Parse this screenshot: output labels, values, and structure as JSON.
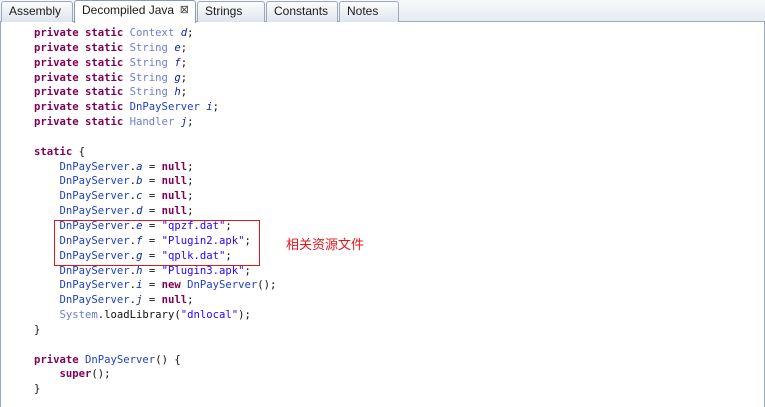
{
  "tabs": [
    {
      "label": "Assembly",
      "active": false
    },
    {
      "label": "Decompiled Java",
      "active": true,
      "close_glyph": "⊠"
    },
    {
      "label": "Strings",
      "active": false
    },
    {
      "label": "Constants",
      "active": false
    },
    {
      "label": "Notes",
      "active": false
    }
  ],
  "code_lines": [
    [
      {
        "t": "private static ",
        "c": "kw"
      },
      {
        "t": "Context",
        "c": "typ"
      },
      {
        "t": " d",
        "c": "fld"
      },
      {
        "t": ";",
        "c": "plain"
      }
    ],
    [
      {
        "t": "private static ",
        "c": "kw"
      },
      {
        "t": "String",
        "c": "typ"
      },
      {
        "t": " e",
        "c": "fld"
      },
      {
        "t": ";",
        "c": "plain"
      }
    ],
    [
      {
        "t": "private static ",
        "c": "kw"
      },
      {
        "t": "String",
        "c": "typ"
      },
      {
        "t": " f",
        "c": "fld"
      },
      {
        "t": ";",
        "c": "plain"
      }
    ],
    [
      {
        "t": "private static ",
        "c": "kw"
      },
      {
        "t": "String",
        "c": "typ"
      },
      {
        "t": " g",
        "c": "fld"
      },
      {
        "t": ";",
        "c": "plain"
      }
    ],
    [
      {
        "t": "private static ",
        "c": "kw"
      },
      {
        "t": "String",
        "c": "typ"
      },
      {
        "t": " h",
        "c": "fld"
      },
      {
        "t": ";",
        "c": "plain"
      }
    ],
    [
      {
        "t": "private static ",
        "c": "kw"
      },
      {
        "t": "DnPayServer",
        "c": "cls"
      },
      {
        "t": " i",
        "c": "fld"
      },
      {
        "t": ";",
        "c": "plain"
      }
    ],
    [
      {
        "t": "private static ",
        "c": "kw"
      },
      {
        "t": "Handler",
        "c": "typ"
      },
      {
        "t": " j",
        "c": "fld"
      },
      {
        "t": ";",
        "c": "plain"
      }
    ],
    [],
    [
      {
        "t": "static",
        "c": "kw"
      },
      {
        "t": " {",
        "c": "plain"
      }
    ],
    [
      {
        "t": "    DnPayServer",
        "c": "cls"
      },
      {
        "t": ".",
        "c": "plain"
      },
      {
        "t": "a",
        "c": "fld"
      },
      {
        "t": " = ",
        "c": "plain"
      },
      {
        "t": "null",
        "c": "kw"
      },
      {
        "t": ";",
        "c": "plain"
      }
    ],
    [
      {
        "t": "    DnPayServer",
        "c": "cls"
      },
      {
        "t": ".",
        "c": "plain"
      },
      {
        "t": "b",
        "c": "fld"
      },
      {
        "t": " = ",
        "c": "plain"
      },
      {
        "t": "null",
        "c": "kw"
      },
      {
        "t": ";",
        "c": "plain"
      }
    ],
    [
      {
        "t": "    DnPayServer",
        "c": "cls"
      },
      {
        "t": ".",
        "c": "plain"
      },
      {
        "t": "c",
        "c": "fld"
      },
      {
        "t": " = ",
        "c": "plain"
      },
      {
        "t": "null",
        "c": "kw"
      },
      {
        "t": ";",
        "c": "plain"
      }
    ],
    [
      {
        "t": "    DnPayServer",
        "c": "cls"
      },
      {
        "t": ".",
        "c": "plain"
      },
      {
        "t": "d",
        "c": "fld"
      },
      {
        "t": " = ",
        "c": "plain"
      },
      {
        "t": "null",
        "c": "kw"
      },
      {
        "t": ";",
        "c": "plain"
      }
    ],
    [
      {
        "t": "    DnPayServer",
        "c": "cls"
      },
      {
        "t": ".",
        "c": "plain"
      },
      {
        "t": "e",
        "c": "fld"
      },
      {
        "t": " = ",
        "c": "plain"
      },
      {
        "t": "\"qpzf.dat\"",
        "c": "str"
      },
      {
        "t": ";",
        "c": "plain"
      }
    ],
    [
      {
        "t": "    DnPayServer",
        "c": "cls"
      },
      {
        "t": ".",
        "c": "plain"
      },
      {
        "t": "f",
        "c": "fld"
      },
      {
        "t": " = ",
        "c": "plain"
      },
      {
        "t": "\"Plugin2.apk\"",
        "c": "str"
      },
      {
        "t": ";",
        "c": "plain"
      }
    ],
    [
      {
        "t": "    DnPayServer",
        "c": "cls"
      },
      {
        "t": ".",
        "c": "plain"
      },
      {
        "t": "g",
        "c": "fld"
      },
      {
        "t": " = ",
        "c": "plain"
      },
      {
        "t": "\"qplk.dat\"",
        "c": "str"
      },
      {
        "t": ";",
        "c": "plain"
      }
    ],
    [
      {
        "t": "    DnPayServer",
        "c": "cls"
      },
      {
        "t": ".",
        "c": "plain"
      },
      {
        "t": "h",
        "c": "fld"
      },
      {
        "t": " = ",
        "c": "plain"
      },
      {
        "t": "\"Plugin3.apk\"",
        "c": "str"
      },
      {
        "t": ";",
        "c": "plain"
      }
    ],
    [
      {
        "t": "    DnPayServer",
        "c": "cls"
      },
      {
        "t": ".",
        "c": "plain"
      },
      {
        "t": "i",
        "c": "fld"
      },
      {
        "t": " = ",
        "c": "plain"
      },
      {
        "t": "new ",
        "c": "kw"
      },
      {
        "t": "DnPayServer",
        "c": "cls"
      },
      {
        "t": "();",
        "c": "plain"
      }
    ],
    [
      {
        "t": "    DnPayServer",
        "c": "cls"
      },
      {
        "t": ".",
        "c": "plain"
      },
      {
        "t": "j",
        "c": "fld"
      },
      {
        "t": " = ",
        "c": "plain"
      },
      {
        "t": "null",
        "c": "kw"
      },
      {
        "t": ";",
        "c": "plain"
      }
    ],
    [
      {
        "t": "    System",
        "c": "typ"
      },
      {
        "t": ".loadLibrary(",
        "c": "plain"
      },
      {
        "t": "\"dnlocal\"",
        "c": "str"
      },
      {
        "t": ");",
        "c": "plain"
      }
    ],
    [
      {
        "t": "}",
        "c": "plain"
      }
    ],
    [],
    [
      {
        "t": "private ",
        "c": "kw"
      },
      {
        "t": "DnPayServer",
        "c": "cls"
      },
      {
        "t": "() {",
        "c": "plain"
      }
    ],
    [
      {
        "t": "    super",
        "c": "kw"
      },
      {
        "t": "();",
        "c": "plain"
      }
    ],
    [
      {
        "t": "}",
        "c": "plain"
      }
    ]
  ],
  "annotation": {
    "text": "相关资源文件",
    "color": "#e0161b"
  },
  "colors": {
    "keyword": "#7f0055",
    "type": "#6d7dd3",
    "class": "#1f3fc2",
    "field": "#0d24a8",
    "string": "#2a00ff",
    "highlight_box": "#e0161b"
  }
}
